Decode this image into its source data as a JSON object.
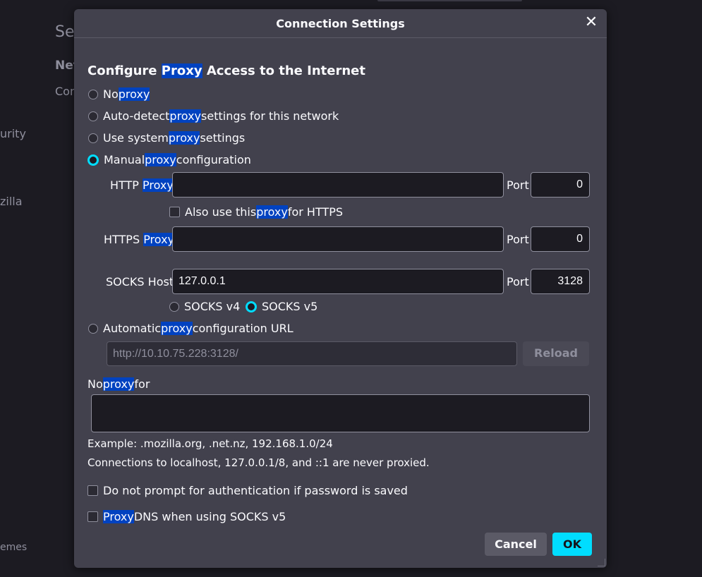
{
  "background": {
    "title_partial": "Se",
    "network_partial": "Net",
    "config_partial": "Con",
    "sidebar_security": "urity",
    "sidebar_mozilla": "zilla",
    "sidebar_themes": "emes"
  },
  "dialog": {
    "title": "Connection Settings",
    "close_glyph": "✕",
    "heading_pre": "Configure ",
    "heading_hl": "Proxy",
    "heading_post": " Access to the Internet",
    "options": {
      "no_proxy": {
        "pre": "No ",
        "hl": "proxy"
      },
      "auto_detect": {
        "pre": "Auto-detect ",
        "hl": "proxy",
        "post": " settings for this network"
      },
      "system": {
        "pre": "Use system ",
        "hl": "proxy",
        "post": " settings"
      },
      "manual": {
        "pre": "Manual ",
        "hl": "proxy",
        "post": " configuration"
      },
      "auto_url": {
        "pre": "Automatic ",
        "hl": "proxy",
        "post": " configuration URL"
      }
    },
    "selected_option": "manual",
    "http": {
      "label_pre": "HTTP ",
      "label_hl": "Proxy",
      "value": "",
      "port_label": "Port",
      "port": "0"
    },
    "also_https": {
      "pre": "Also use this ",
      "hl": "proxy",
      "post": " for HTTPS",
      "checked": false
    },
    "https": {
      "label_pre": "HTTPS ",
      "label_hl": "Proxy",
      "value": "",
      "port_label": "Port",
      "port": "0"
    },
    "socks": {
      "label": "SOCKS Host",
      "value": "127.0.0.1",
      "port_label": "Port",
      "port": "3128",
      "v4": "SOCKS v4",
      "v5": "SOCKS v5",
      "selected": "v5"
    },
    "auto_url_value": "http://10.10.75.228:3128/",
    "reload_label": "Reload",
    "no_proxy_for": {
      "pre": "No ",
      "hl": "proxy",
      "post": " for",
      "value": ""
    },
    "example": "Example: .mozilla.org, .net.nz, 192.168.1.0/24",
    "localhost_note": "Connections to localhost, 127.0.0.1/8, and ::1 are never proxied.",
    "no_prompt_auth": {
      "label": "Do not prompt for authentication if password is saved",
      "checked": false
    },
    "proxy_dns": {
      "hl": "Proxy",
      "post": " DNS when using SOCKS v5",
      "checked": false
    },
    "cancel_label": "Cancel",
    "ok_label": "OK"
  },
  "colors": {
    "accent": "#00ddff",
    "highlight": "#0042c0",
    "dialog_bg": "#42414d",
    "page_bg": "#1c1b22"
  }
}
